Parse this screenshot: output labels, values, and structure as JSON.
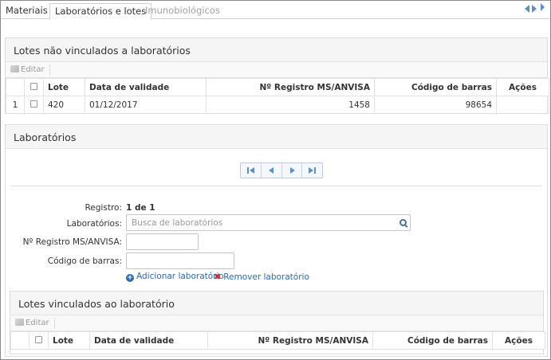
{
  "tabs": [
    {
      "label": "Materiais"
    },
    {
      "label": "Laboratórios e lotes"
    },
    {
      "label": "Imunobiológicos"
    }
  ],
  "unlinked_panel": {
    "title": "Lotes não vinculados a laboratórios",
    "edit_label": "Editar",
    "columns": [
      "Lote",
      "Data de validade",
      "Nº Registro MS/ANVISA",
      "Código de barras",
      "Ações"
    ],
    "rows": [
      {
        "index": "1",
        "lote": "420",
        "validade": "01/12/2017",
        "registro": "1458",
        "codigo": "98654",
        "acoes": ""
      }
    ]
  },
  "labs_panel": {
    "title": "Laboratórios",
    "registro_label": "Registro:",
    "registro_value": "1 de 1",
    "laboratorios_label": "Laboratórios:",
    "laboratorios_placeholder": "Busca de laboratórios",
    "registro_ms_label": "Nº Registro MS/ANVISA:",
    "registro_ms_value": "",
    "codigo_label": "Código de barras:",
    "codigo_value": "",
    "add_label": "Adicionar laboratório",
    "remove_label": "Remover laboratório"
  },
  "linked_panel": {
    "title": "Lotes vinculados ao laboratório",
    "edit_label": "Editar",
    "columns": [
      "Lote",
      "Data de validade",
      "Nº Registro MS/ANVISA",
      "Código de barras",
      "Ações"
    ]
  },
  "colors": {
    "accent": "#2c6aa8",
    "remove": "#cc2a2a"
  }
}
